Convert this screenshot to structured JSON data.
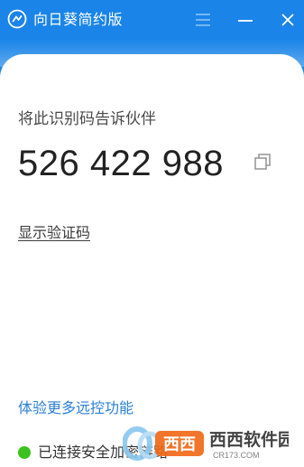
{
  "app": {
    "title": "向日葵简约版"
  },
  "main": {
    "partner_label": "将此识别码告诉伙伴",
    "id_code": "526 422 988",
    "show_code_link": "显示验证码",
    "more_features_link": "体验更多远控功能"
  },
  "status": {
    "text": "已连接安全加密链路",
    "color": "#3cc21e"
  },
  "watermark": {
    "brand": "西西软件园",
    "domain": "CR173.COM"
  },
  "colors": {
    "accent": "#1a84e8",
    "link": "#2a7fd6"
  }
}
